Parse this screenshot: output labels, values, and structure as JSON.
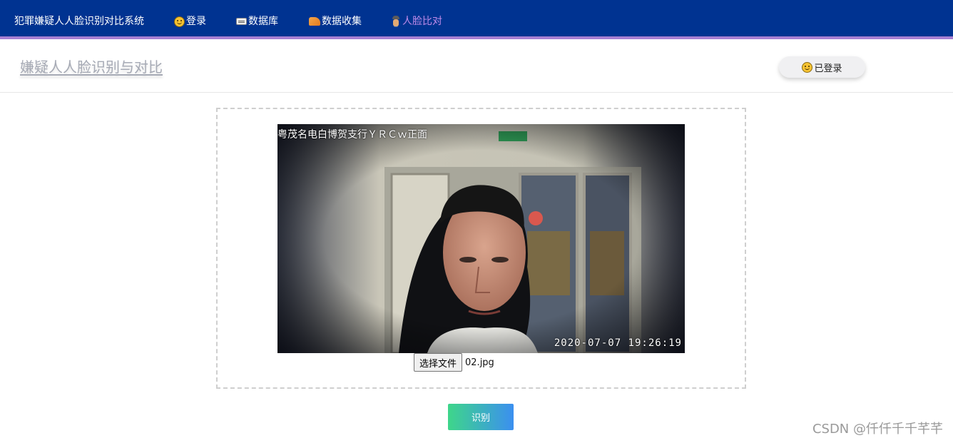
{
  "navbar": {
    "brand": "犯罪嫌疑人人脸识别对比系统",
    "items": [
      {
        "label": "登录",
        "icon": "smile-icon"
      },
      {
        "label": "数据库",
        "icon": "card-icon"
      },
      {
        "label": "数据收集",
        "icon": "writing-hand-icon"
      },
      {
        "label": "人脸比对",
        "icon": "detective-icon",
        "active": true
      }
    ],
    "colors": {
      "background": "#003391",
      "accent": "#a77fd3",
      "active_text": "#c08be9"
    }
  },
  "header": {
    "title": "嫌疑人人脸识别与对比",
    "status_label": "已登录",
    "status_icon": "smile-icon"
  },
  "upload": {
    "image_caption_top": "粤茂名电白博贺支行ＹＲＣｗ正面",
    "image_timestamp": "2020-07-07 19:26:19",
    "choose_file_label": "选择文件",
    "file_name": "02.jpg"
  },
  "actions": {
    "identify_label": "识别"
  },
  "watermark": "CSDN @仟仟千千芊芊"
}
